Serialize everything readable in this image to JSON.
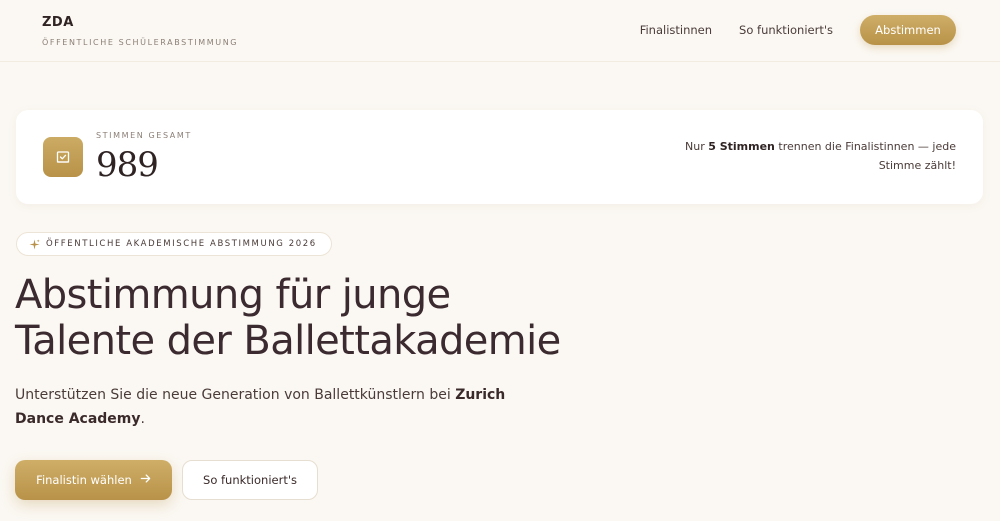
{
  "header": {
    "brand_name": "ZDA",
    "brand_subtitle": "ÖFFENTLICHE SCHÜLERABSTIMMUNG",
    "nav_finalists": "Finalistinnen",
    "nav_how": "So funktioniert's",
    "nav_vote_button": "Abstimmen"
  },
  "stats": {
    "icon": "ballot-box-icon",
    "label": "STIMMEN GESAMT",
    "value": "989",
    "note_prefix": "Nur ",
    "note_highlight": "5 Stimmen",
    "note_suffix": " trennen die Finalistinnen — jede Stimme zählt!"
  },
  "badge": {
    "icon": "sparkle-icon",
    "text": "ÖFFENTLICHE AKADEMISCHE ABSTIMMUNG 2026"
  },
  "hero": {
    "title_line1": "Abstimmung für junge",
    "title_line2": "Talente der Ballettakademie",
    "desc_prefix": "Unterstützen Sie die neue Generation von Ballettkünstlern bei ",
    "desc_highlight": "Zurich Dance Academy",
    "desc_suffix": "."
  },
  "actions": {
    "primary_label": "Finalistin wählen",
    "primary_icon": "arrow-right-icon",
    "secondary_label": "So funktioniert's"
  },
  "colors": {
    "accent": "#c4a15a",
    "background": "#fbf8f3",
    "text": "#3b2a2a"
  }
}
